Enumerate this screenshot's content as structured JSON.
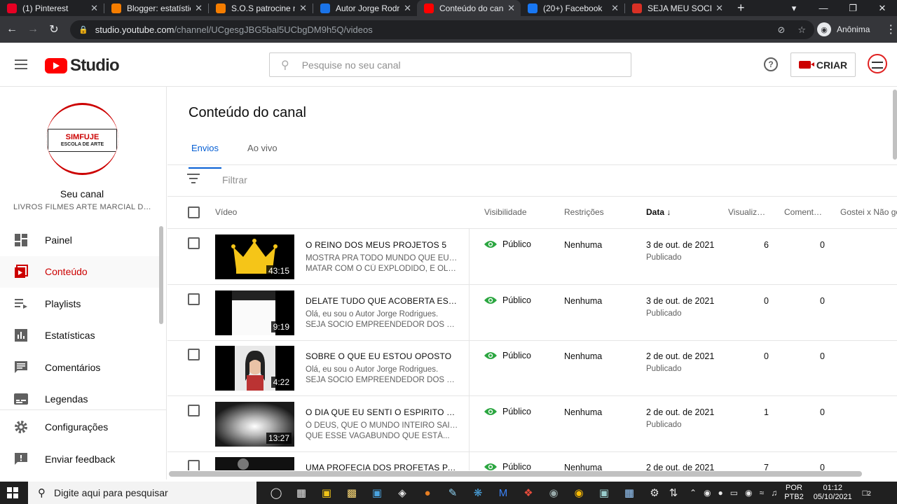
{
  "browser": {
    "tabs": [
      {
        "title": "(1) Pinterest",
        "icon": "pinterest-icon",
        "color": "#e60023",
        "active": false
      },
      {
        "title": "Blogger: estatísticas",
        "icon": "blogger-icon",
        "color": "#f57d00",
        "active": false
      },
      {
        "title": "S.O.S patrocine meu",
        "icon": "blogger-icon",
        "color": "#f57d00",
        "active": false
      },
      {
        "title": "Autor Jorge Rodrigues",
        "icon": "site-icon",
        "color": "#1a73e8",
        "active": false
      },
      {
        "title": "Conteúdo do canal",
        "icon": "youtube-icon",
        "color": "#ff0000",
        "active": true
      },
      {
        "title": "(20+) Facebook",
        "icon": "facebook-icon",
        "color": "#1877f2",
        "active": false
      },
      {
        "title": "SEJA MEU SOCIO",
        "icon": "gmail-icon",
        "color": "#d93025",
        "active": false
      }
    ],
    "url_host": "studio.youtube.com",
    "url_path": "/channel/UCgesgJBG5bal5UCbgDM9h5Q/videos",
    "profile_label": "Anônima"
  },
  "header": {
    "logo_text": "Studio",
    "search_placeholder": "Pesquise no seu canal",
    "create_label": "CRIAR",
    "help_glyph": "?"
  },
  "sidebar": {
    "logo_line1": "SIMFUJE",
    "logo_line2": "ESCOLA DE ARTE",
    "channel_title": "Seu canal",
    "channel_desc": "LIVROS FILMES ARTE MARCIAL DESENHOS",
    "items": [
      {
        "label": "Painel",
        "icon": "dashboard-icon"
      },
      {
        "label": "Conteúdo",
        "icon": "content-icon",
        "selected": true
      },
      {
        "label": "Playlists",
        "icon": "playlist-icon"
      },
      {
        "label": "Estatísticas",
        "icon": "analytics-icon"
      },
      {
        "label": "Comentários",
        "icon": "comments-icon"
      },
      {
        "label": "Legendas",
        "icon": "subtitles-icon"
      }
    ],
    "bottom": [
      {
        "label": "Configurações",
        "icon": "gear-icon"
      },
      {
        "label": "Enviar feedback",
        "icon": "feedback-icon"
      }
    ]
  },
  "main": {
    "title": "Conteúdo do canal",
    "tabs": [
      {
        "label": "Envios",
        "active": true
      },
      {
        "label": "Ao vivo",
        "active": false
      }
    ],
    "filter_placeholder": "Filtrar",
    "columns": {
      "video": "Vídeo",
      "visibility": "Visibilidade",
      "restrictions": "Restrições",
      "date": "Data",
      "views": "Visualizações",
      "comments": "Comentários",
      "likes": "Gostei x Não gostei"
    },
    "rows": [
      {
        "title": "O REINO DOS MEUS PROJETOS 5",
        "desc1": "MOSTRA PRA TODO MUNDO QUE EU VOU",
        "desc2": "MATAR COM O CÚ EXPLODIDO, E OLHO...",
        "duration": "43:15",
        "visibility": "Público",
        "restrictions": "Nenhuma",
        "date": "3 de out. de 2021",
        "status": "Publicado",
        "views": "6",
        "comments": "0",
        "thumb": "crown"
      },
      {
        "title": "DELATE TUDO QUE ACOBERTA ESPIONAGEM",
        "desc1": "Olá, eu sou o Autor Jorge Rodrigues.",
        "desc2": "SEJA SOCIO EMPREENDEDOR DOS MEUS",
        "duration": "9:19",
        "visibility": "Público",
        "restrictions": "Nenhuma",
        "date": "3 de out. de 2021",
        "status": "Publicado",
        "views": "0",
        "comments": "0",
        "thumb": "dark"
      },
      {
        "title": "SOBRE O QUE EU ESTOU OPOSTO",
        "desc1": "Olá, eu sou o Autor Jorge Rodrigues.",
        "desc2": "SEJA SOCIO EMPREENDEDOR DOS MEUS",
        "duration": "4:22",
        "visibility": "Público",
        "restrictions": "Nenhuma",
        "date": "2 de out. de 2021",
        "status": "Publicado",
        "views": "0",
        "comments": "0",
        "thumb": "face"
      },
      {
        "title": "O DIA QUE EU SENTI O ESPIRITO SANTO",
        "desc1": "Ó DEUS, QUE O MUNDO INTEIRO SAIBA",
        "desc2": "QUE ESSE VAGABUNDO QUE ESTÁ...",
        "duration": "13:27",
        "visibility": "Público",
        "restrictions": "Nenhuma",
        "date": "2 de out. de 2021",
        "status": "Publicado",
        "views": "1",
        "comments": "0",
        "thumb": "light"
      },
      {
        "title": "UMA PROFECIA DOS PROFETAS PARA",
        "desc1": "",
        "desc2": "",
        "duration": "",
        "visibility": "Público",
        "restrictions": "Nenhuma",
        "date": "2 de out. de 2021",
        "status": "",
        "views": "7",
        "comments": "0",
        "thumb": "dark2"
      }
    ]
  },
  "taskbar": {
    "search_placeholder": "Digite aqui para pesquisar",
    "lang1": "POR",
    "lang2": "PTB2",
    "time": "01:12",
    "date": "05/10/2021",
    "notif_count": "2"
  }
}
